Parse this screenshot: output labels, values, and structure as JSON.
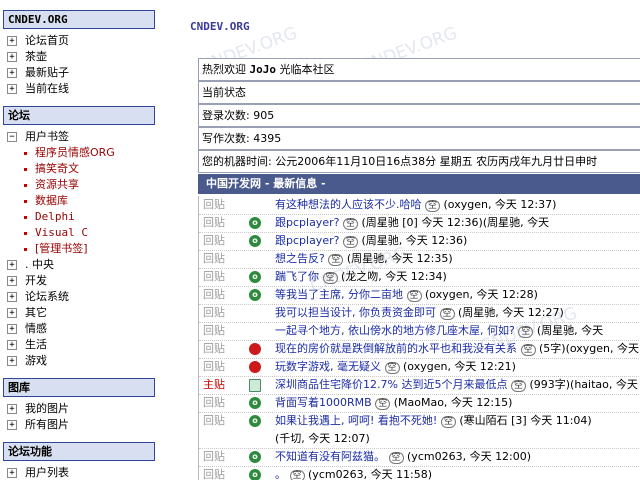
{
  "sidebar": {
    "site_heading": "CNDEV.ORG",
    "site_links": [
      "论坛首页",
      "茶壶",
      "最新贴子",
      "当前在线"
    ],
    "forum_heading": "论坛",
    "bookmark_label": "用户书签",
    "bookmarks": [
      "程序员情感ORG",
      "搞笑奇文",
      "资源共享",
      "数据库",
      "Delphi",
      "Visual C",
      "[管理书签]"
    ],
    "forum_items": [
      ". 中央",
      "开发",
      "论坛系统",
      "其它",
      "情感",
      "生活",
      "游戏"
    ],
    "gallery_heading": "图库",
    "gallery_items": [
      "我的图片",
      "所有图片"
    ],
    "functions_heading": "论坛功能",
    "function_items": [
      "用户列表"
    ]
  },
  "main": {
    "title": "CNDEV.ORG",
    "watermark": "CNDEV.ORG",
    "welcome_prefix": "热烈欢迎",
    "welcome_user": "JoJo",
    "welcome_suffix": "光临本社区",
    "status_label": "当前状态",
    "login_label": "登录次数:",
    "login_count": "905",
    "post_label": "写作次数:",
    "post_count": "4395",
    "machine_time": "您的机器时间: 公元2006年11月10日16点38分 星期五 农历丙戌年九月廿日申时",
    "news_header": "中国开发网 - 最新信息 -",
    "space_badge": "空",
    "news": [
      {
        "tag": "回贴",
        "icon": "none",
        "title": "有这种想法的人应该不少.哈哈",
        "meta": "(oxygen, 今天 12:37)"
      },
      {
        "tag": "回贴",
        "icon": "green",
        "title": "跟pcplayer?",
        "meta": "(周星驰 [0] 今天 12:36)(周星驰, 今天"
      },
      {
        "tag": "回贴",
        "icon": "green",
        "title": "跟pcplayer?",
        "meta": "(周星驰, 今天 12:36)"
      },
      {
        "tag": "回贴",
        "icon": "none",
        "title": "想之告反?",
        "meta": "(周星驰, 今天 12:35)"
      },
      {
        "tag": "回贴",
        "icon": "green",
        "title": "踹飞了你",
        "meta": "(龙之吻, 今天 12:34)"
      },
      {
        "tag": "回贴",
        "icon": "green",
        "title": "等我当了主席, 分你二亩地",
        "meta": "(oxygen, 今天 12:28)"
      },
      {
        "tag": "回贴",
        "icon": "none",
        "title": "我可以担当设计, 你负责资金即可",
        "meta": "(周星驰, 今天 12:27)"
      },
      {
        "tag": "回贴",
        "icon": "none",
        "title": "一起寻个地方, 依山傍水的地方修几座木屋, 何如?",
        "meta": "(周星驰, 今天"
      },
      {
        "tag": "回贴",
        "icon": "red",
        "title": "现在的房价就是跌倒解放前的水平也和我没有关系",
        "meta": "(5字)(oxygen, 今天"
      },
      {
        "tag": "回贴",
        "icon": "red",
        "title": "玩数字游戏, 毫无疑义",
        "meta": "(oxygen, 今天 12:21)"
      },
      {
        "tag": "主贴",
        "icon": "doc",
        "title": "深圳商品住宅降价12.7% 达到近5个月来最低点",
        "meta": "(993字)(haitao, 今天"
      },
      {
        "tag": "回贴",
        "icon": "green",
        "title": "背面写着1000RMB",
        "meta": "(MaoMao, 今天 12:15)"
      },
      {
        "tag": "回贴",
        "icon": "green",
        "title": "如果让我遇上, 呵呵! 看抱不死她!",
        "meta": "(寒山陌石 [3] 今天 11:04)",
        "meta2": "(千切, 今天 12:07)"
      },
      {
        "tag": "回贴",
        "icon": "green",
        "title": "不知道有没有阿兹猫。",
        "meta": "(ycm0263, 今天 12:00)"
      },
      {
        "tag": "回贴",
        "icon": "green",
        "title": "。",
        "meta": "(ycm0263, 今天 11:58)"
      }
    ]
  }
}
